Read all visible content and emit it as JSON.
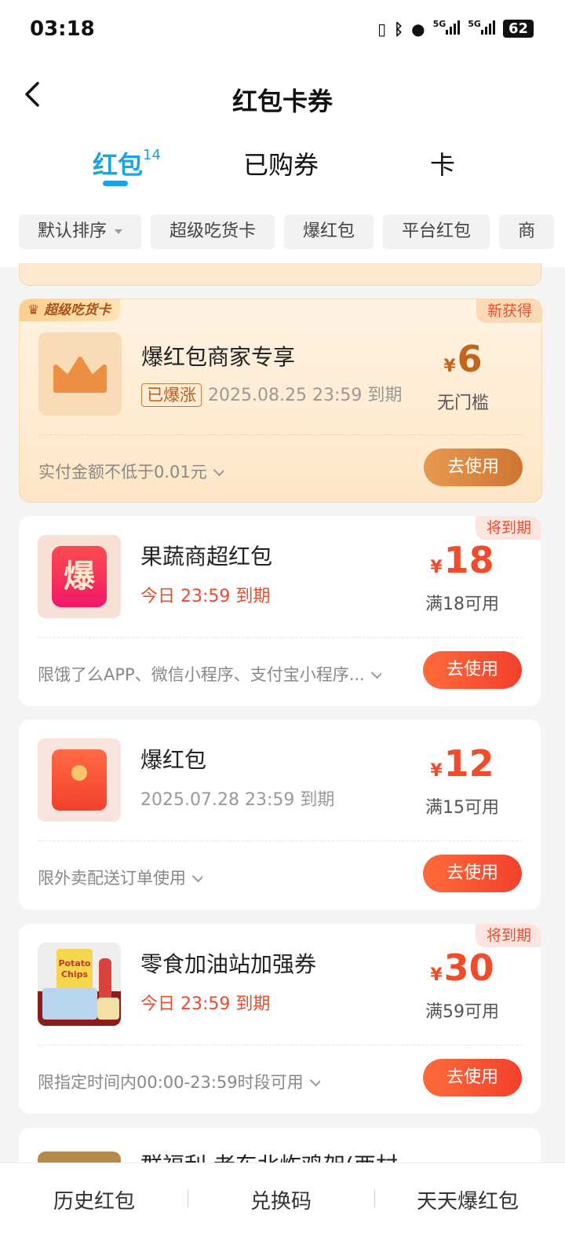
{
  "status": {
    "time": "03:18",
    "sig1": "5G",
    "sig2": "5G",
    "battery": "62"
  },
  "nav": {
    "title": "红包卡券"
  },
  "tabs": [
    {
      "label": "红包",
      "count": "14"
    },
    {
      "label": "已购券"
    },
    {
      "label": "卡"
    }
  ],
  "filters": [
    "默认排序",
    "超级吃货卡",
    "爆红包",
    "平台红包",
    "商"
  ],
  "cards": [
    {
      "badge": "超级吃货卡",
      "flag": "新获得",
      "title": "爆红包商家专享",
      "tag": "已爆涨",
      "expire": "2025.08.25 23:59 到期",
      "currency": "¥",
      "amount": "6",
      "condition": "无门槛",
      "note": "实付金额不低于0.01元",
      "button": "去使用"
    },
    {
      "flag": "将到期",
      "title": "果蔬商超红包",
      "thumb_text": "爆",
      "expire": "今日 23:59 到期",
      "currency": "¥",
      "amount": "18",
      "condition": "满18可用",
      "note": "限饿了么APP、微信小程序、支付宝小程序...",
      "button": "去使用"
    },
    {
      "title": "爆红包",
      "expire": "2025.07.28 23:59 到期",
      "currency": "¥",
      "amount": "12",
      "condition": "满15可用",
      "note": "限外卖配送订单使用",
      "button": "去使用"
    },
    {
      "flag": "将到期",
      "title": "零食加油站加强券",
      "thumb_text": "Potato Chips",
      "expire": "今日 23:59 到期",
      "currency": "¥",
      "amount": "30",
      "condition": "满59可用",
      "note": "限指定时间内00:00-23:59时段可用",
      "button": "去使用"
    },
    {
      "title": "群福利·老东北炸鸡架(西村"
    }
  ],
  "bottom": [
    "历史红包",
    "兑换码",
    "天天爆红包"
  ],
  "colors": {
    "accent": "#1aa3e8",
    "red": "#f34a2a",
    "gold": "#c4651d"
  }
}
